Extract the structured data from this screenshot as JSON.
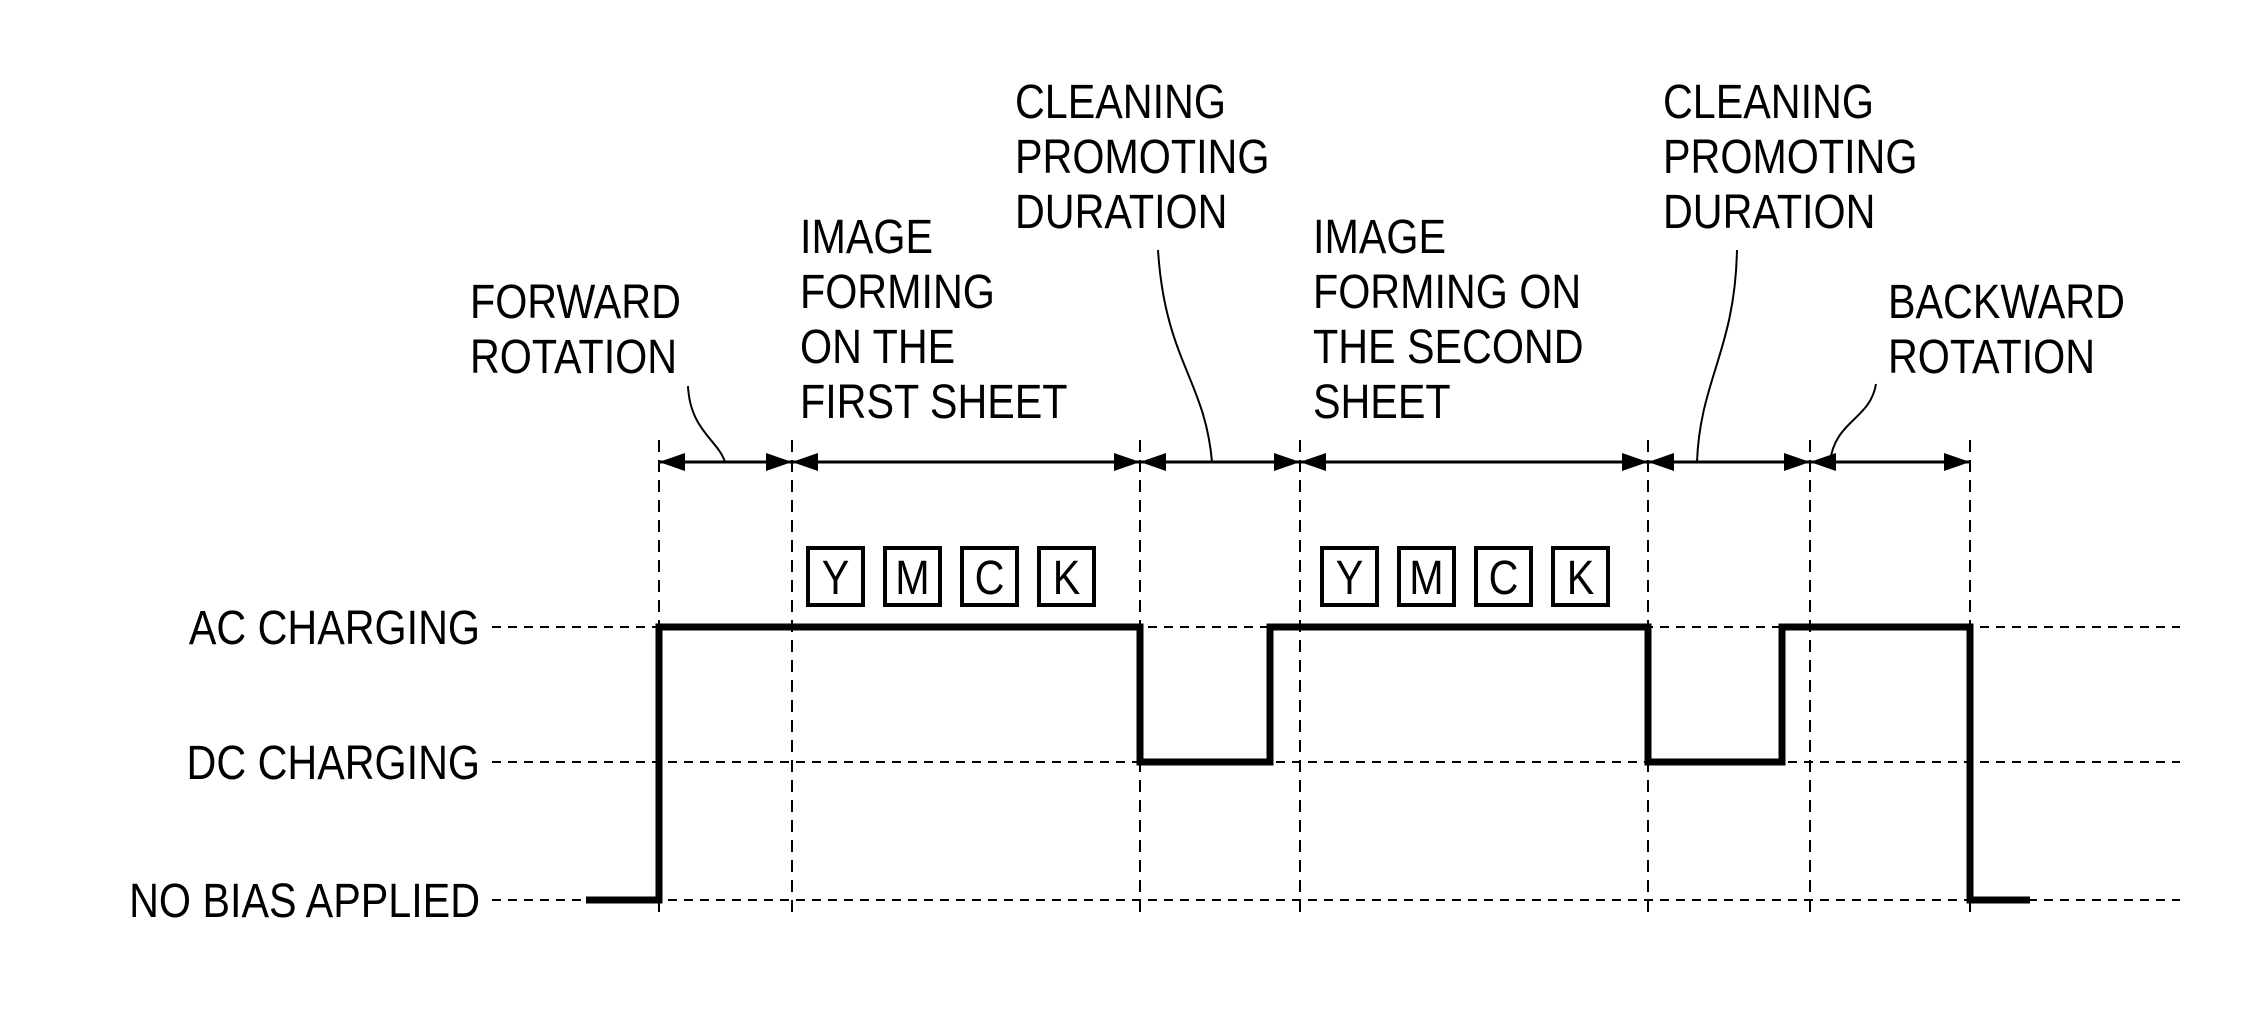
{
  "levels": [
    {
      "id": "ac",
      "label": "AC CHARGING"
    },
    {
      "id": "dc",
      "label": "DC CHARGING"
    },
    {
      "id": "none",
      "label": "NO BIAS APPLIED"
    }
  ],
  "periods": [
    {
      "lines": [
        "FORWARD",
        "ROTATION"
      ]
    },
    {
      "lines": [
        "IMAGE",
        "FORMING",
        "ON THE",
        "FIRST SHEET"
      ]
    },
    {
      "lines": [
        "CLEANING",
        "PROMOTING",
        "DURATION"
      ]
    },
    {
      "lines": [
        "IMAGE",
        "FORMING ON",
        "THE SECOND",
        "SHEET"
      ]
    },
    {
      "lines": [
        "CLEANING",
        "PROMOTING",
        "DURATION"
      ]
    },
    {
      "lines": [
        "BACKWARD",
        "ROTATION"
      ]
    }
  ],
  "color_boxes": [
    "Y",
    "M",
    "C",
    "K"
  ],
  "signal_sequence": [
    "none",
    "ac",
    "ac",
    "dc",
    "ac",
    "dc",
    "ac",
    "none"
  ],
  "colors": {
    "ink": "#000000",
    "background": "#ffffff"
  }
}
